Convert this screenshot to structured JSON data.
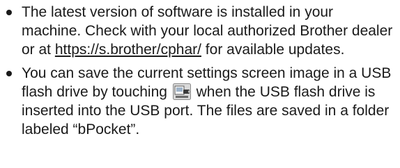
{
  "items": [
    {
      "text_before": "The latest version of software is installed in your machine. Check with your local authorized Brother dealer or at ",
      "link": "https://s.brother/cphar/",
      "text_after": " for available updates."
    },
    {
      "text_before": "You can save the current settings screen image in a USB flash drive by touching ",
      "icon": "usb-save-screen-icon",
      "text_after": " when the USB flash drive is inserted into the USB port. The files are saved in a folder labeled “bPocket”."
    }
  ]
}
